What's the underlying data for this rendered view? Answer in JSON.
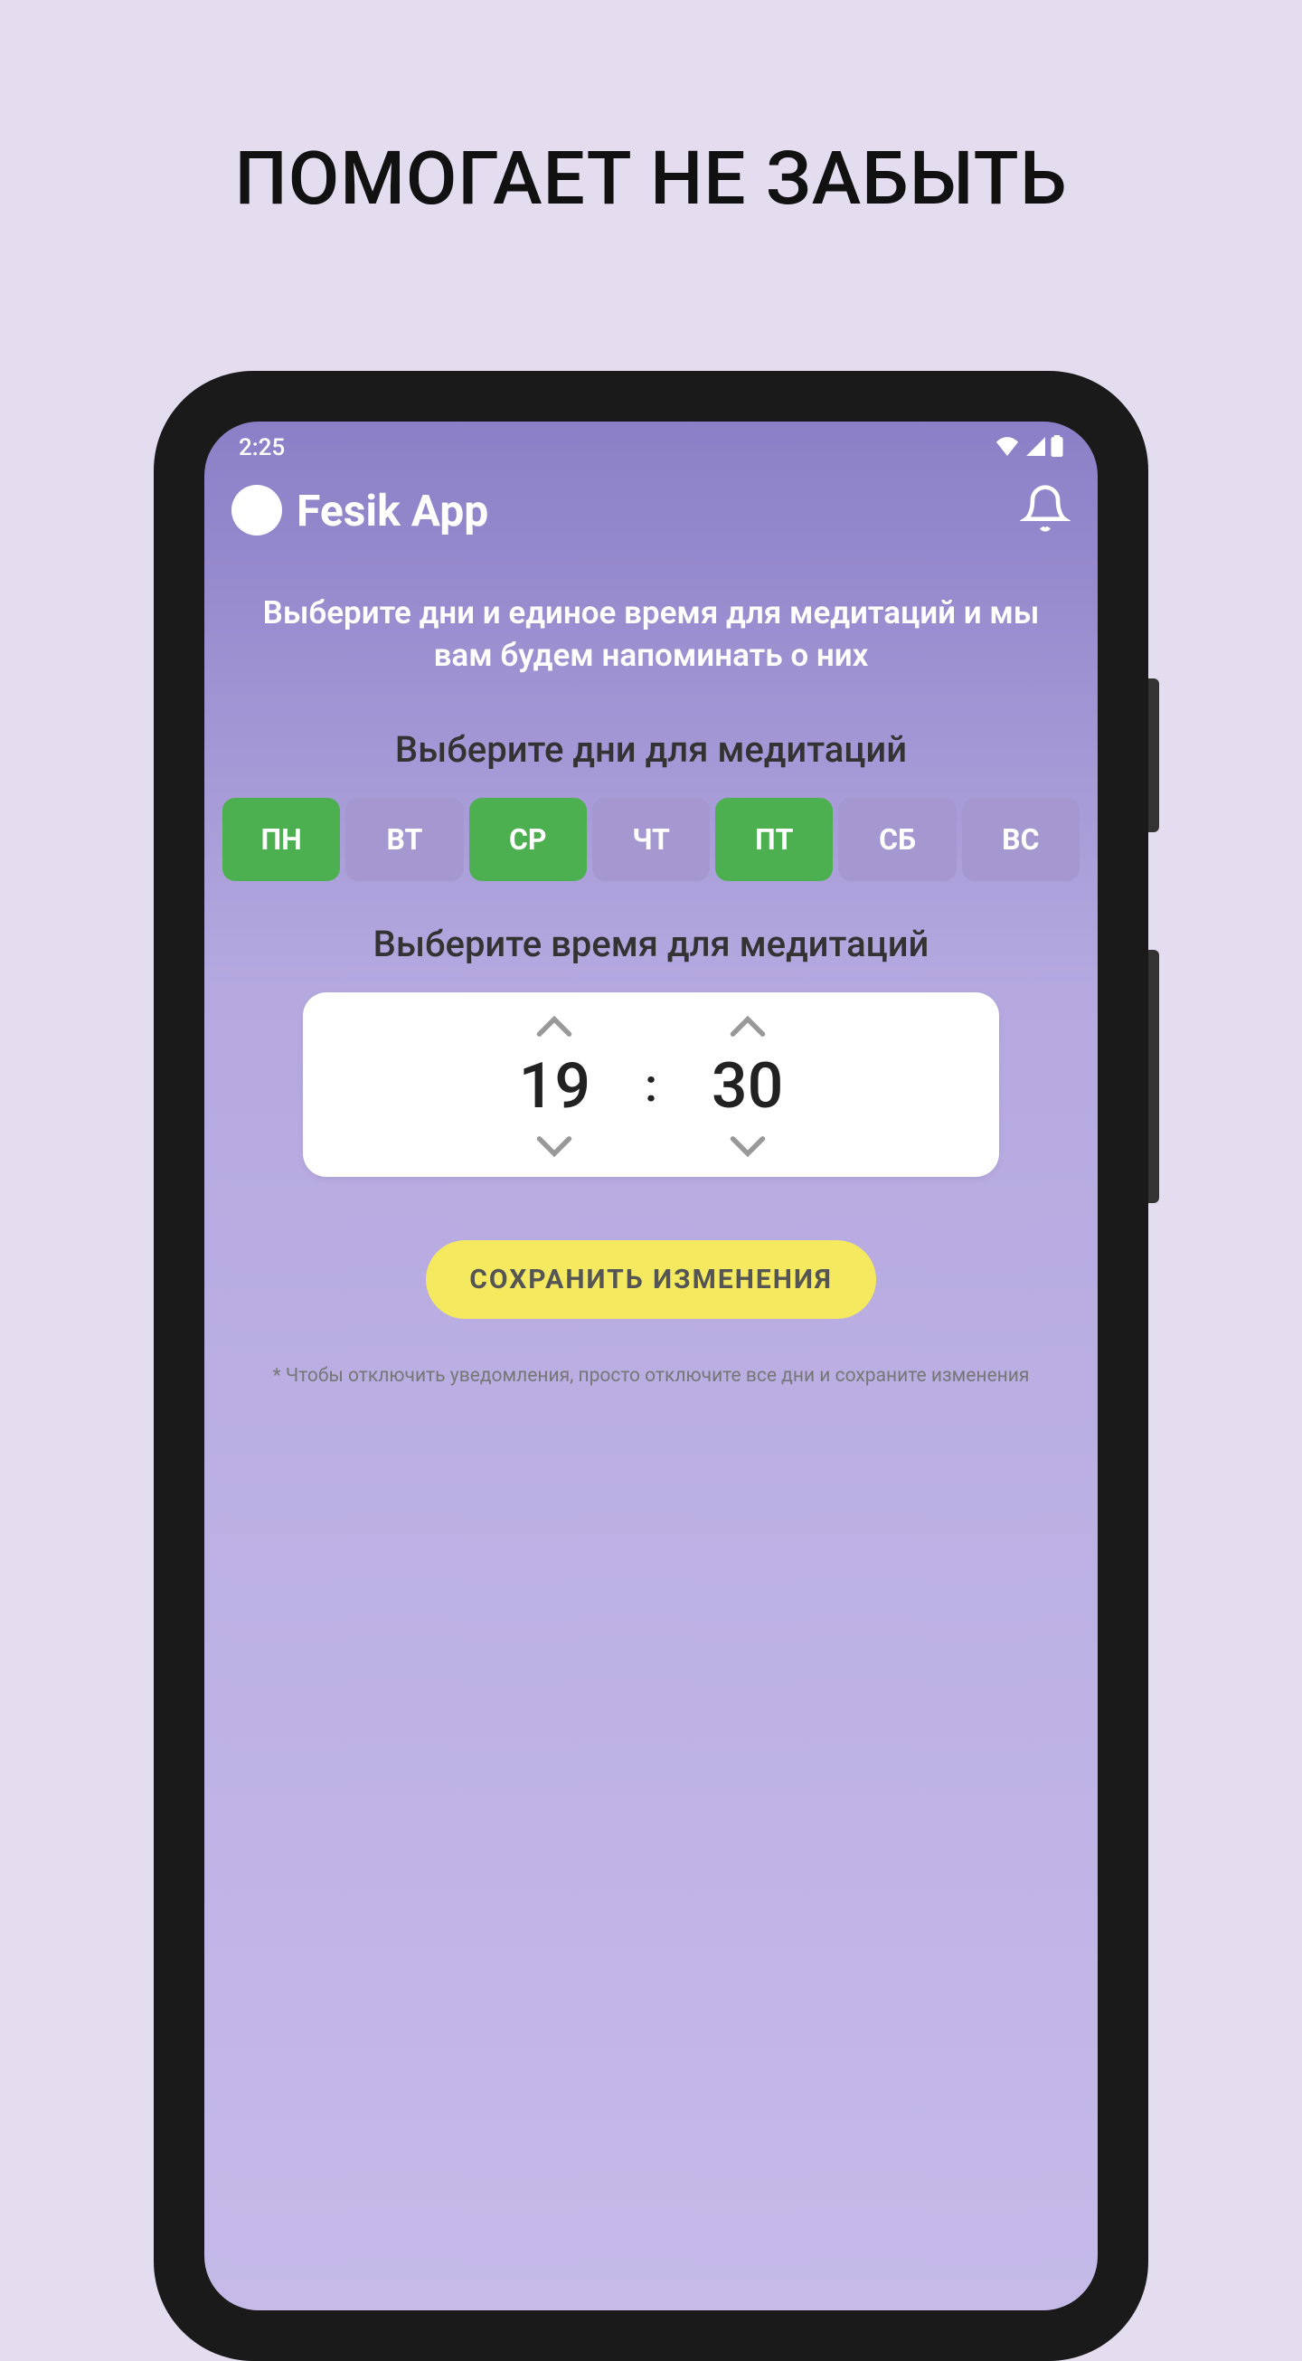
{
  "page": {
    "title": "ПОМОГАЕТ НЕ ЗАБЫТЬ"
  },
  "status": {
    "time": "2:25"
  },
  "header": {
    "app_name": "Fesik App"
  },
  "intro": "Выберите дни и единое время для медитаций и мы вам будем напоминать о них",
  "days_title": "Выберите дни для медитаций",
  "days": [
    {
      "label": "ПН",
      "selected": true
    },
    {
      "label": "ВТ",
      "selected": false
    },
    {
      "label": "СР",
      "selected": true
    },
    {
      "label": "ЧТ",
      "selected": false
    },
    {
      "label": "ПТ",
      "selected": true
    },
    {
      "label": "СБ",
      "selected": false
    },
    {
      "label": "ВС",
      "selected": false
    }
  ],
  "time_title": "Выберите время для медитаций",
  "time": {
    "hour": "19",
    "minute": "30",
    "separator": ":"
  },
  "save_label": "СОХРАНИТЬ ИЗМЕНЕНИЯ",
  "footnote": "* Чтобы отключить уведомления, просто отключите все дни и сохраните изменения"
}
